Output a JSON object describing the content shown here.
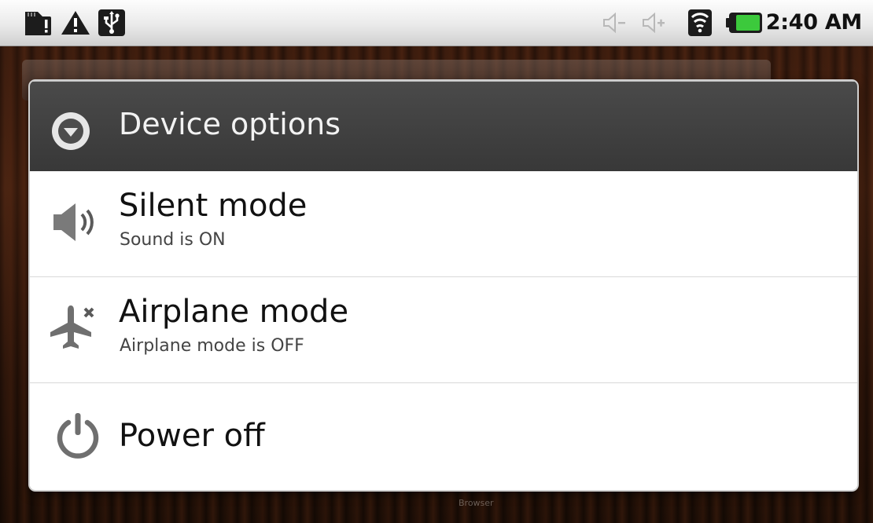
{
  "status_bar": {
    "time": "2:40 AM",
    "left_icons": [
      "sd-card-warning-icon",
      "warning-icon",
      "usb-icon"
    ],
    "right_icons": [
      "volume-down-icon",
      "volume-up-icon",
      "wifi-icon",
      "battery-icon"
    ],
    "battery_color": "#3cc93c"
  },
  "dialog": {
    "title": "Device options",
    "options": [
      {
        "title": "Silent mode",
        "subtitle": "Sound is ON",
        "icon": "speaker-icon"
      },
      {
        "title": "Airplane mode",
        "subtitle": "Airplane mode is OFF",
        "icon": "airplane-icon"
      },
      {
        "title": "Power off",
        "subtitle": "",
        "icon": "power-icon"
      }
    ]
  },
  "background": {
    "dock_label": "Browser"
  }
}
